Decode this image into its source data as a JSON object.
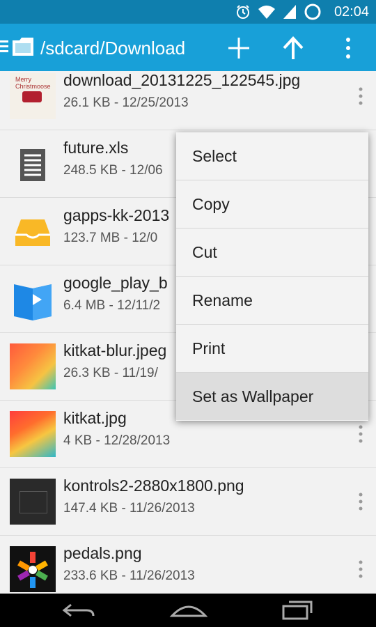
{
  "status_bar": {
    "time": "02:04",
    "icons": [
      "alarm-icon",
      "wifi-icon",
      "signal-icon",
      "battery-icon"
    ]
  },
  "app_bar": {
    "path": "/sdcard/Download",
    "actions": [
      "add-icon",
      "up-arrow-icon",
      "overflow-menu-icon"
    ]
  },
  "files": [
    {
      "name": "download_20131225_122545.jpg",
      "meta": "26.1 KB - 12/25/2013",
      "thumb_text": "Merry Christmoose"
    },
    {
      "name": "future.xls",
      "meta": "248.5 KB - 12/06"
    },
    {
      "name": "gapps-kk-2013",
      "meta": "123.7 MB - 12/0"
    },
    {
      "name": "google_play_b",
      "meta": "6.4 MB - 12/11/2"
    },
    {
      "name": "kitkat-blur.jpeg",
      "meta": "26.3 KB - 11/19/"
    },
    {
      "name": "kitkat.jpg",
      "meta": "4 KB - 12/28/2013"
    },
    {
      "name": "kontrols2-2880x1800.png",
      "meta": "147.4 KB - 11/26/2013"
    },
    {
      "name": "pedals.png",
      "meta": "233.6 KB - 11/26/2013"
    }
  ],
  "context_menu": {
    "items": [
      "Select",
      "Copy",
      "Cut",
      "Rename",
      "Print",
      "Set as Wallpaper"
    ],
    "selected": "Set as Wallpaper"
  },
  "nav_bar": {
    "buttons": [
      "back-icon",
      "home-icon",
      "recents-icon"
    ]
  },
  "colors": {
    "status_bar": "#0f7fae",
    "app_bar": "#18a0d8",
    "list_bg": "#f2f2f2",
    "menu_bg": "#f3f3f3"
  }
}
